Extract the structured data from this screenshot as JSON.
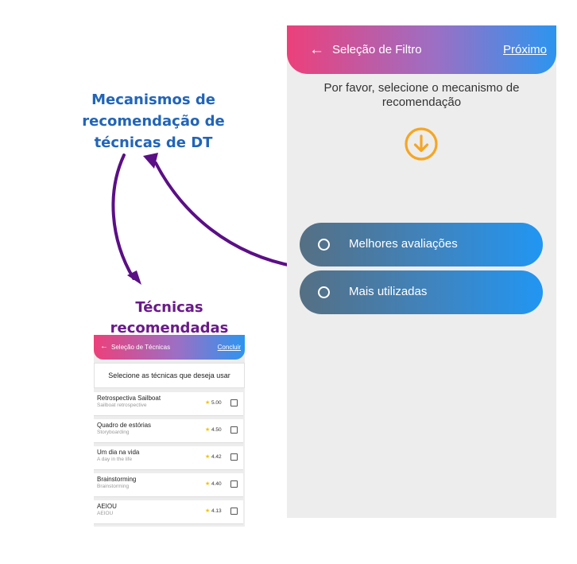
{
  "main_screen": {
    "header": {
      "back_icon": "arrow-left-icon",
      "title": "Seleção de Filtro",
      "next_label": "Próximo"
    },
    "subtitle_line1": "Por favor, selecione o mecanismo de",
    "subtitle_line2": "recomendação",
    "down_icon": "arrow-down-circle-icon",
    "options": [
      {
        "label": "Melhores avaliações",
        "selected": false
      },
      {
        "label": "Mais utilizadas",
        "selected": false
      }
    ],
    "colors": {
      "accent_pink": "#ec407a",
      "accent_blue": "#2196f3",
      "icon_orange": "#f5a623"
    }
  },
  "annotations": {
    "top_line1": "Mecanismos de",
    "top_line2": "recomendação de",
    "top_line3": "técnicas de DT",
    "bottom_line1": "Técnicas",
    "bottom_line2": "recomendadas"
  },
  "small_screen": {
    "header": {
      "back_icon": "arrow-left-icon",
      "title": "Seleção de Técnicas",
      "done_label": "Concluir"
    },
    "subtitle": "Selecione as técnicas que deseja usar",
    "techniques": [
      {
        "name": "Retrospectiva Sailboat",
        "subtitle": "Sailboat retrospective",
        "rating": "5.00"
      },
      {
        "name": "Quadro de estórias",
        "subtitle": "Storyboarding",
        "rating": "4.50"
      },
      {
        "name": "Um dia na vida",
        "subtitle": "A day in the life",
        "rating": "4.42"
      },
      {
        "name": "Brainstorming",
        "subtitle": "Brainstorming",
        "rating": "4.40"
      },
      {
        "name": "AEIOU",
        "subtitle": "AEIOU",
        "rating": "4.13"
      }
    ]
  }
}
